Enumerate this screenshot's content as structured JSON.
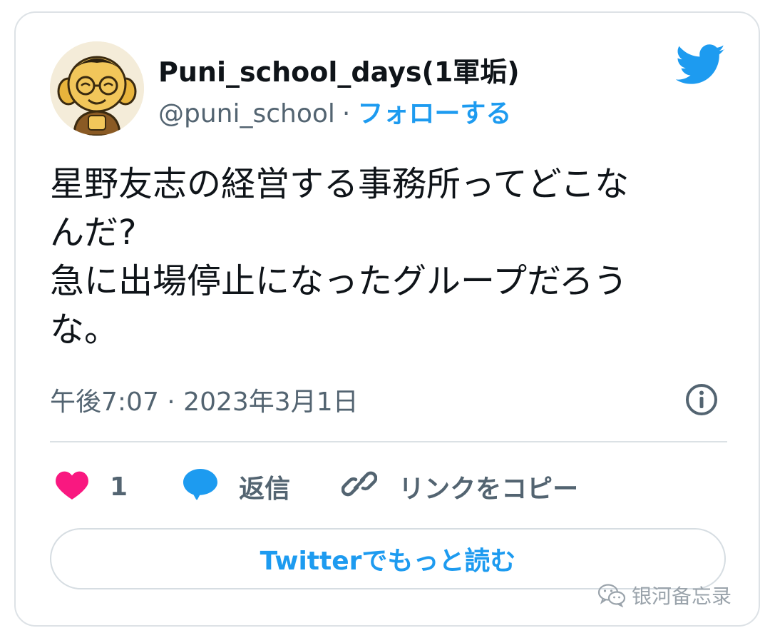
{
  "tweet": {
    "display_name": "Puni_school_days(1軍垢)",
    "handle": "@puni_school",
    "separator": "·",
    "follow_label": "フォローする",
    "text": "星野友志の経営する事務所ってどこな\nんだ?\n急に出場停止になったグループだろう\nな。",
    "timestamp": "午後7:07 · 2023年3月1日"
  },
  "actions": {
    "like_count": "1",
    "reply_label": "返信",
    "copy_link_label": "リンクをコピー"
  },
  "read_more_label": "Twitterでもっと読む",
  "watermark": "银河备忘录",
  "icons": {
    "brand": "twitter-bird-icon",
    "info": "info-icon",
    "like": "heart-icon",
    "reply": "speech-bubble-icon",
    "copy": "link-icon",
    "watermark": "wechat-icon"
  },
  "colors": {
    "accent": "#1d9bf0",
    "like": "#f91880",
    "text": "#0f1419",
    "secondary": "#536471"
  }
}
